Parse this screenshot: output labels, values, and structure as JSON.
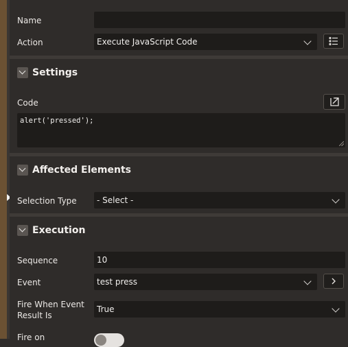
{
  "form": {
    "name": {
      "label": "Name",
      "value": ""
    },
    "action": {
      "label": "Action",
      "value": "Execute JavaScript Code"
    }
  },
  "settings": {
    "title": "Settings",
    "code_label": "Code",
    "code_value": "alert('pressed');"
  },
  "affected": {
    "title": "Affected Elements",
    "selection_type_label": "Selection Type",
    "selection_type_value": "- Select -"
  },
  "execution": {
    "title": "Execution",
    "sequence_label": "Sequence",
    "sequence_value": "10",
    "event_label": "Event",
    "event_value": "test press",
    "fire_when_label_line1": "Fire When Event",
    "fire_when_label_line2": "Result Is",
    "fire_when_value": "True",
    "fire_on_label": "Fire on"
  },
  "icons": {
    "action_list": "list-icon",
    "code_expand": "expand-icon",
    "event_go": "chevron-right-icon",
    "section_toggle": "chevron-down-icon"
  },
  "colors": {
    "background": "#2f2c2a",
    "field": "#1e1c1a",
    "accent_bar": "#6b5133"
  }
}
